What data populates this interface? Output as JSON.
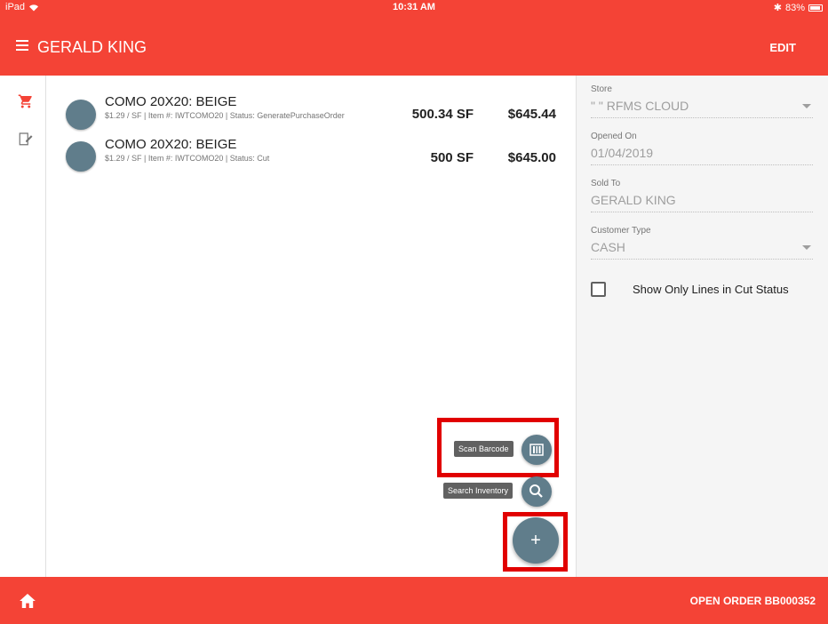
{
  "status_bar": {
    "device": "iPad",
    "time": "10:31 AM",
    "battery": "83%"
  },
  "app_bar": {
    "title": "GERALD KING",
    "edit_label": "EDIT"
  },
  "line_items": [
    {
      "name": "COMO 20X20: BEIGE",
      "details": "$1.29 / SF  |  Item #: IWTCOMO20  |  Status: GeneratePurchaseOrder",
      "quantity": "500.34 SF",
      "price": "$645.44"
    },
    {
      "name": "COMO 20X20: BEIGE",
      "details": "$1.29 / SF  |  Item #: IWTCOMO20  |  Status: Cut",
      "quantity": "500 SF",
      "price": "$645.00"
    }
  ],
  "fab_actions": {
    "scan_barcode": "Scan Barcode",
    "search_inventory": "Search Inventory",
    "add": "+"
  },
  "side_panel": {
    "store": {
      "label": "Store",
      "value": "\" \" RFMS CLOUD"
    },
    "opened_on": {
      "label": "Opened On",
      "value": "01/04/2019"
    },
    "sold_to": {
      "label": "Sold To",
      "value": "GERALD KING"
    },
    "customer_type": {
      "label": "Customer Type",
      "value": "CASH"
    },
    "cut_filter_label": "Show Only Lines in Cut Status"
  },
  "bottom_bar": {
    "order_text": "OPEN ORDER BB000352"
  },
  "colors": {
    "accent": "#f44336",
    "fab": "#607d8b",
    "highlight": "#e10000"
  }
}
